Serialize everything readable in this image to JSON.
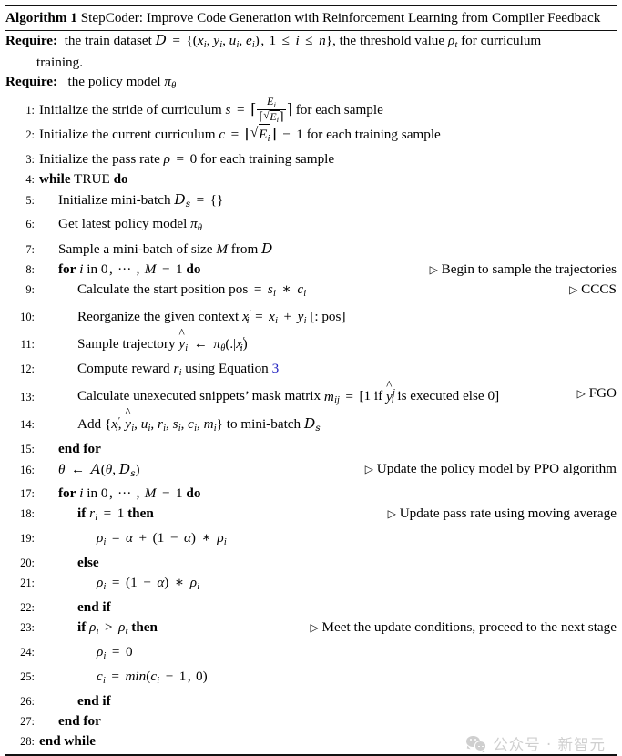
{
  "document": {
    "type": "algorithm-float",
    "title_label": "Algorithm 1",
    "title_text": "StepCoder: Improve Code Generation with Reinforcement Learning from Compiler Feedback"
  },
  "requires": [
    {
      "keyword": "Require:",
      "text": "the train dataset D = {(x_i, y_i, u_i, e_i), 1 ≤ i ≤ n}, the threshold value ρ_t for curriculum training."
    },
    {
      "keyword": "Require:",
      "text": "the policy model π_θ"
    }
  ],
  "lines": [
    {
      "num": "1:",
      "indent": 1,
      "text": "Initialize the stride of curriculum s = ⌈E_i / ⌈√E_i⌉⌉ for each sample",
      "comment": ""
    },
    {
      "num": "2:",
      "indent": 1,
      "text": "Initialize the current curriculum c = ⌈√E_i⌉ − 1 for each training sample",
      "comment": ""
    },
    {
      "num": "3:",
      "indent": 1,
      "text": "Initialize the pass rate ρ = 0 for each training sample",
      "comment": ""
    },
    {
      "num": "4:",
      "indent": 1,
      "text": "while TRUE do",
      "comment": ""
    },
    {
      "num": "5:",
      "indent": 2,
      "text": "Initialize mini-batch D_s = {}",
      "comment": ""
    },
    {
      "num": "6:",
      "indent": 2,
      "text": "Get latest policy model π_θ",
      "comment": ""
    },
    {
      "num": "7:",
      "indent": 2,
      "text": "Sample a mini-batch of size M from D",
      "comment": ""
    },
    {
      "num": "8:",
      "indent": 2,
      "text": "for i in 0, ⋯ , M − 1 do",
      "comment": "Begin to sample the trajectories"
    },
    {
      "num": "9:",
      "indent": 3,
      "text": "Calculate the start position pos = s_i * c_i",
      "comment": "CCCS"
    },
    {
      "num": "10:",
      "indent": 3,
      "text": "Reorganize the given context x'_i = x_i + y_i [: pos]",
      "comment": ""
    },
    {
      "num": "11:",
      "indent": 3,
      "text": "Sample trajectory ŷ_i ← π_θ(.|x'_i)",
      "comment": ""
    },
    {
      "num": "12:",
      "indent": 3,
      "text": "Compute reward r_i using Equation 3",
      "comment": "",
      "link": "3"
    },
    {
      "num": "13:",
      "indent": 3,
      "text": "Calculate unexecuted snippets’ mask matrix m_ij = [1 if ŷ_i^j is executed else 0]",
      "comment": "FGO"
    },
    {
      "num": "14:",
      "indent": 3,
      "text": "Add {x'_i, ŷ_i, u_i, r_i, s_i, c_i, m_i} to mini-batch D_s",
      "comment": ""
    },
    {
      "num": "15:",
      "indent": 2,
      "text": "end for",
      "comment": ""
    },
    {
      "num": "16:",
      "indent": 2,
      "text": "θ ← A(θ, D_s)",
      "comment": "Update the policy model by PPO algorithm"
    },
    {
      "num": "17:",
      "indent": 2,
      "text": "for i in 0, ⋯ , M − 1 do",
      "comment": ""
    },
    {
      "num": "18:",
      "indent": 3,
      "text": "if r_i = 1 then",
      "comment": "Update pass rate using moving average"
    },
    {
      "num": "19:",
      "indent": 4,
      "text": "ρ_i = α + (1 − α) * ρ_i",
      "comment": ""
    },
    {
      "num": "20:",
      "indent": 3,
      "text": "else",
      "comment": ""
    },
    {
      "num": "21:",
      "indent": 4,
      "text": "ρ_i = (1 − α) * ρ_i",
      "comment": ""
    },
    {
      "num": "22:",
      "indent": 3,
      "text": "end if",
      "comment": ""
    },
    {
      "num": "23:",
      "indent": 3,
      "text": "if ρ_i > ρ_t then",
      "comment": "Meet the update conditions, proceed to the next stage"
    },
    {
      "num": "24:",
      "indent": 4,
      "text": "ρ_i = 0",
      "comment": ""
    },
    {
      "num": "25:",
      "indent": 4,
      "text": "c_i = min(c_i − 1, 0)",
      "comment": ""
    },
    {
      "num": "26:",
      "indent": 3,
      "text": "end if",
      "comment": ""
    },
    {
      "num": "27:",
      "indent": 2,
      "text": "end for",
      "comment": ""
    },
    {
      "num": "28:",
      "indent": 1,
      "text": "end while",
      "comment": ""
    }
  ],
  "watermark": {
    "icon": "wechat-icon",
    "text": "公众号 · 新智元",
    "color": "#cfcfcf"
  },
  "colors": {
    "text": "#000000",
    "rule": "#111111",
    "link": "#2020c0",
    "background": "#ffffff"
  }
}
